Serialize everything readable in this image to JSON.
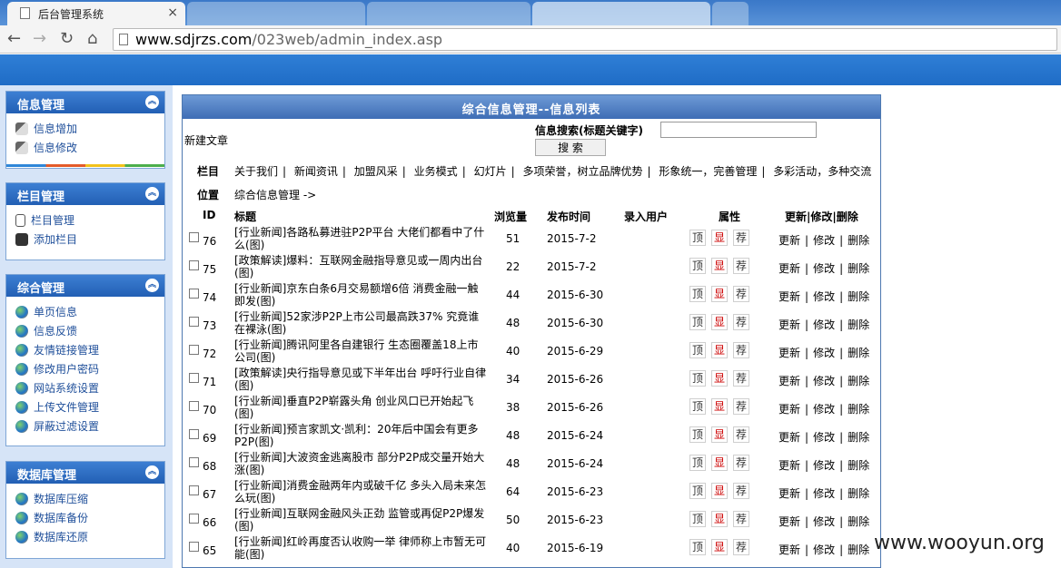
{
  "browser": {
    "active_tab_title": "后台管理系统",
    "inactive_tabs": [
      "",
      "",
      "",
      "",
      ""
    ],
    "url_host": "www.sdjrzs.com",
    "url_path": "/023web/admin_index.asp"
  },
  "sidebar": {
    "panels": [
      {
        "title": "信息管理",
        "items": [
          "信息增加",
          "信息修改"
        ]
      },
      {
        "title": "栏目管理",
        "items": [
          "栏目管理",
          "添加栏目"
        ]
      },
      {
        "title": "综合管理",
        "items": [
          "单页信息",
          "信息反馈",
          "友情链接管理",
          "修改用户密码",
          "网站系统设置",
          "上传文件管理",
          "屏蔽过滤设置"
        ]
      },
      {
        "title": "数据库管理",
        "items": [
          "数据库压缩",
          "数据库备份",
          "数据库还原"
        ]
      }
    ]
  },
  "main": {
    "title": "综合信息管理--信息列表",
    "new_article": "新建文章",
    "search_label": "信息搜索(标题关键字)",
    "search_value": "",
    "search_button": "搜 索",
    "category_label": "栏目",
    "categories": [
      "关于我们",
      "新闻资讯",
      "加盟风采",
      "业务模式",
      "幻灯片",
      "多项荣誉，树立品牌优势",
      "形象统一，完善管理",
      "多彩活动，多种交流"
    ],
    "location_label": "位置",
    "location_value": "综合信息管理 ->",
    "columns": {
      "id": "ID",
      "title": "标题",
      "views": "浏览量",
      "date": "发布时间",
      "user": "录入用户",
      "attrs": "属性",
      "ops": "更新|修改|删除"
    },
    "attr_labels": {
      "top": "顶",
      "show": "显",
      "recommend": "荐"
    },
    "action_labels": {
      "update": "更新",
      "edit": "修改",
      "delete": "删除"
    },
    "rows": [
      {
        "id": "76",
        "title": "[行业新闻]各路私募进驻P2P平台 大佬们都看中了什么(图)",
        "views": "51",
        "date": "2015-7-2"
      },
      {
        "id": "75",
        "title": "[政策解读]爆料：互联网金融指导意见或一周内出台(图)",
        "views": "22",
        "date": "2015-7-2"
      },
      {
        "id": "74",
        "title": "[行业新闻]京东白条6月交易额增6倍 消费金融一触即发(图)",
        "views": "44",
        "date": "2015-6-30"
      },
      {
        "id": "73",
        "title": "[行业新闻]52家涉P2P上市公司最高跌37% 究竟谁在裸泳(图)",
        "views": "48",
        "date": "2015-6-30"
      },
      {
        "id": "72",
        "title": "[行业新闻]腾讯阿里各自建银行 生态圈覆盖18上市公司(图)",
        "views": "40",
        "date": "2015-6-29"
      },
      {
        "id": "71",
        "title": "[政策解读]央行指导意见或下半年出台 呼吁行业自律(图)",
        "views": "34",
        "date": "2015-6-26"
      },
      {
        "id": "70",
        "title": "[行业新闻]垂直P2P崭露头角 创业风口已开始起飞(图)",
        "views": "38",
        "date": "2015-6-26"
      },
      {
        "id": "69",
        "title": "[行业新闻]预言家凯文·凯利：20年后中国会有更多P2P(图)",
        "views": "48",
        "date": "2015-6-24"
      },
      {
        "id": "68",
        "title": "[行业新闻]大波资金逃离股市 部分P2P成交量开始大涨(图)",
        "views": "48",
        "date": "2015-6-24"
      },
      {
        "id": "67",
        "title": "[行业新闻]消费金融两年内或破千亿 多头入局未来怎么玩(图)",
        "views": "64",
        "date": "2015-6-23"
      },
      {
        "id": "66",
        "title": "[行业新闻]互联网金融风头正劲 监管或再促P2P爆发(图)",
        "views": "50",
        "date": "2015-6-23"
      },
      {
        "id": "65",
        "title": "[行业新闻]红岭再度否认收购一举 律师称上市暂无可能(图)",
        "views": "40",
        "date": "2015-6-19"
      }
    ]
  },
  "watermark": "www.wooyun.org"
}
